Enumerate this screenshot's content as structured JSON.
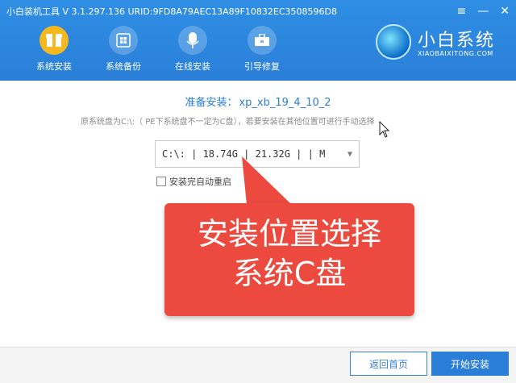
{
  "window": {
    "title": "小白装机工具 V 3.1.297.136 URID:9FD8A79AEC13A89F10832EC3508596D8",
    "controls": {
      "menu": "≡",
      "minimize": "—",
      "close": "✕"
    }
  },
  "nav": {
    "items": [
      {
        "label": "系统安装",
        "icon": "package-icon",
        "active": true
      },
      {
        "label": "系统备份",
        "icon": "windows-backup-icon"
      },
      {
        "label": "在线安装",
        "icon": "download-icon"
      },
      {
        "label": "引导修复",
        "icon": "toolbox-icon"
      }
    ]
  },
  "brand": {
    "name": "小白系统",
    "subtitle": "XIAOBAIXITONG.COM"
  },
  "main": {
    "prepare_label": "准备安装：",
    "prepare_value": "xp_xb_19_4_10_2",
    "hint": "原系统盘为C:\\:（ PE下系统盘不一定为C盘），若要安装在其他位置可进行手动选择",
    "partition": {
      "text": "C:\\: | 18.74G | 21.32G | | M"
    },
    "auto_restart_label": "安装完自动重启"
  },
  "overlay": {
    "line1": "安装位置选择",
    "line2": "系统C盘",
    "color": "#ec4a3e"
  },
  "footer": {
    "back_label": "返回首页",
    "start_label": "开始安装"
  },
  "colors": {
    "accent": "#2b7ed8",
    "header": "#2f8ee4",
    "active_tab": "#f5b81e"
  }
}
